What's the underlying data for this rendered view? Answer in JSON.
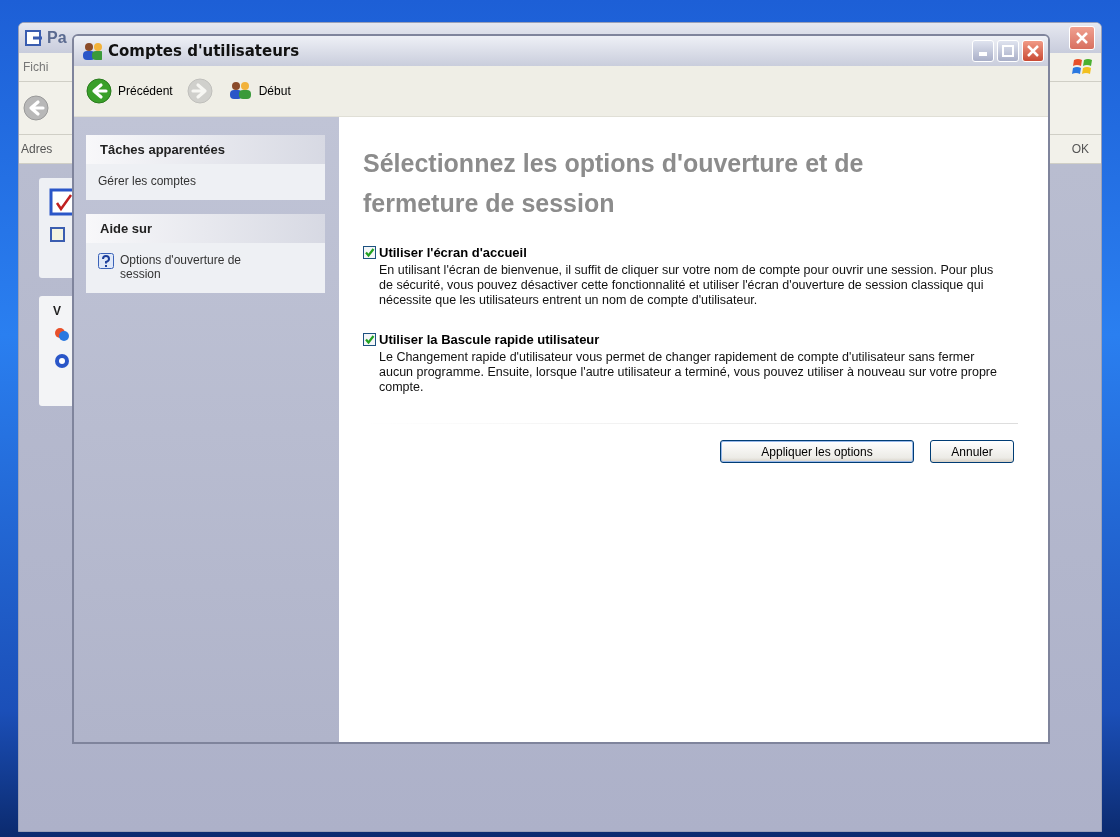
{
  "back_window": {
    "title": "Pa",
    "menu": [
      "Fichi"
    ],
    "address_label": "Adres",
    "go_button": "OK",
    "panel_heading": "V"
  },
  "window": {
    "title": "Comptes d'utilisateurs"
  },
  "toolbar": {
    "back": {
      "label": "Précédent",
      "disabled": false
    },
    "forward": {
      "disabled": true
    },
    "home": {
      "label": "Début"
    }
  },
  "sidebar": {
    "panels": [
      {
        "title": "Tâches apparentées",
        "items": [
          {
            "label": "Gérer les comptes",
            "kind": "link"
          }
        ]
      },
      {
        "title": "Aide sur",
        "items": [
          {
            "label": "Options d'ouverture de session",
            "kind": "help"
          }
        ]
      }
    ]
  },
  "heading": "Sélectionnez les options d'ouverture et de fermeture de session",
  "options": [
    {
      "label": "Utiliser l'écran d'accueil",
      "checked": true,
      "description": "En utilisant l'écran de bienvenue, il suffit de cliquer sur votre nom de compte pour ouvrir une session. Pour plus de sécurité, vous pouvez désactiver cette fonctionnalité et utiliser l'écran d'ouverture de session classique qui nécessite que les utilisateurs entrent un nom de compte d'utilisateur."
    },
    {
      "label": "Utiliser la Bascule rapide utilisateur",
      "checked": true,
      "description": "Le Changement rapide d'utilisateur vous permet de changer rapidement de compte d'utilisateur sans fermer aucun programme. Ensuite, lorsque l'autre utilisateur a terminé, vous pouvez utiliser à nouveau sur votre propre compte."
    }
  ],
  "buttons": [
    {
      "label": "Appliquer les options",
      "kind": "primary"
    },
    {
      "label": "Annuler",
      "kind": "cancel"
    }
  ]
}
